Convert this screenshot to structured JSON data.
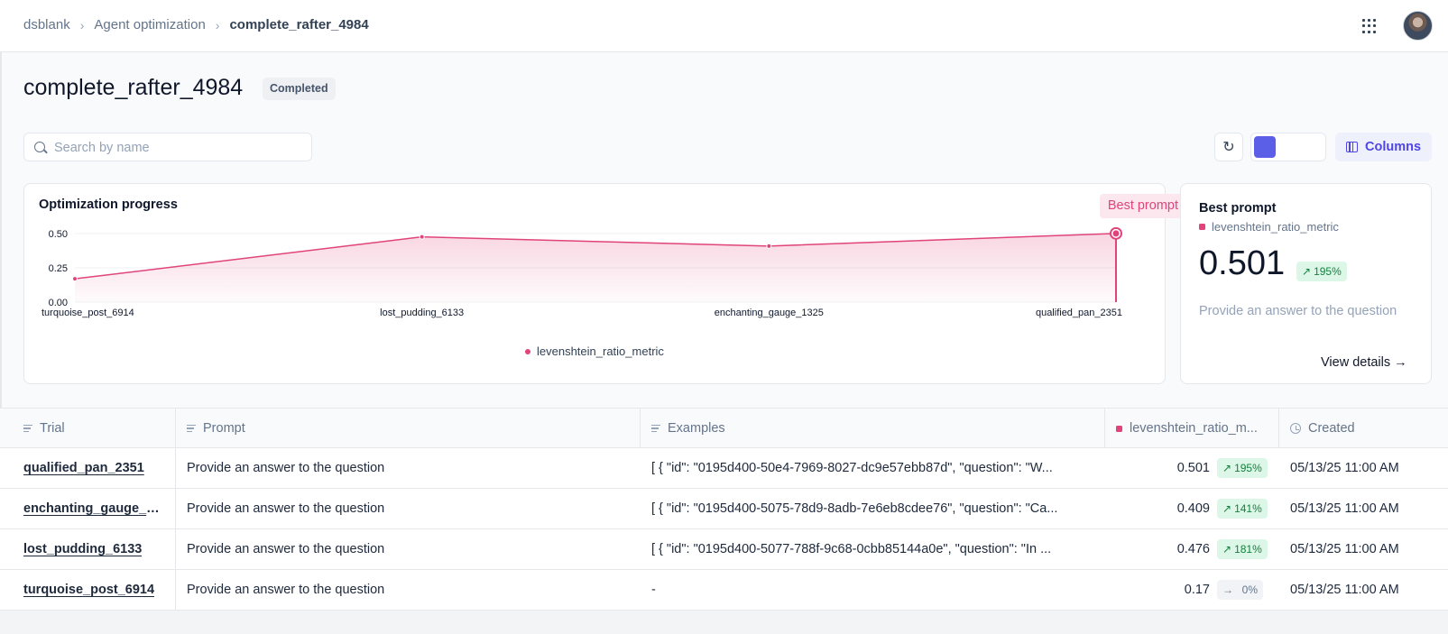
{
  "breadcrumb": {
    "workspace": "dsblank",
    "section": "Agent optimization",
    "current": "complete_rafter_4984"
  },
  "header": {
    "title": "complete_rafter_4984",
    "status": "Completed"
  },
  "search": {
    "placeholder": "Search by name",
    "value": ""
  },
  "toolbar": {
    "columns_label": "Columns"
  },
  "chart_card": {
    "title": "Optimization progress",
    "best_label": "Best prompt"
  },
  "chart_data": {
    "type": "line",
    "title": "Optimization progress",
    "categories": [
      "turquoise_post_6914",
      "lost_pudding_6133",
      "enchanting_gauge_1325",
      "qualified_pan_2351"
    ],
    "series": [
      {
        "name": "levenshtein_ratio_metric",
        "values": [
          0.17,
          0.476,
          0.409,
          0.501
        ],
        "color": "#e0447a"
      }
    ],
    "yticks": [
      "0.00",
      "0.25",
      "0.50"
    ],
    "ylim": [
      0,
      0.5
    ],
    "best_index": 3,
    "legend": "bottom-center",
    "grid": true
  },
  "best_prompt": {
    "title": "Best prompt",
    "metric": "levenshtein_ratio_metric",
    "value": "0.501",
    "change": "195%",
    "prompt": "Provide an answer to the question",
    "view_details": "View details →"
  },
  "table": {
    "columns": [
      "Trial",
      "Prompt",
      "Examples",
      "levenshtein_ratio_m...",
      "Created"
    ],
    "rows": [
      {
        "trial": "qualified_pan_2351",
        "prompt": "Provide an answer to the question",
        "examples": "[ { \"id\": \"0195d400-50e4-7969-8027-dc9e57ebb87d\", \"question\": \"W...",
        "score": "0.501",
        "change": "195%",
        "created": "05/13/25 11:00 AM"
      },
      {
        "trial": "enchanting_gauge_1...",
        "prompt": "Provide an answer to the question",
        "examples": "[ { \"id\": \"0195d400-5075-78d9-8adb-7e6eb8cdee76\", \"question\": \"Ca...",
        "score": "0.409",
        "change": "141%",
        "created": "05/13/25 11:00 AM"
      },
      {
        "trial": "lost_pudding_6133",
        "prompt": "Provide an answer to the question",
        "examples": "[ { \"id\": \"0195d400-5077-788f-9c68-0cbb85144a0e\", \"question\": \"In ...",
        "score": "0.476",
        "change": "181%",
        "created": "05/13/25 11:00 AM"
      },
      {
        "trial": "turquoise_post_6914",
        "prompt": "Provide an answer to the question",
        "examples": "-",
        "score": "0.17",
        "change": "0%",
        "created": "05/13/25 11:00 AM"
      }
    ]
  },
  "colors": {
    "accent": "#5b5ee6",
    "metric": "#e0447a",
    "positive": "#15803d"
  }
}
